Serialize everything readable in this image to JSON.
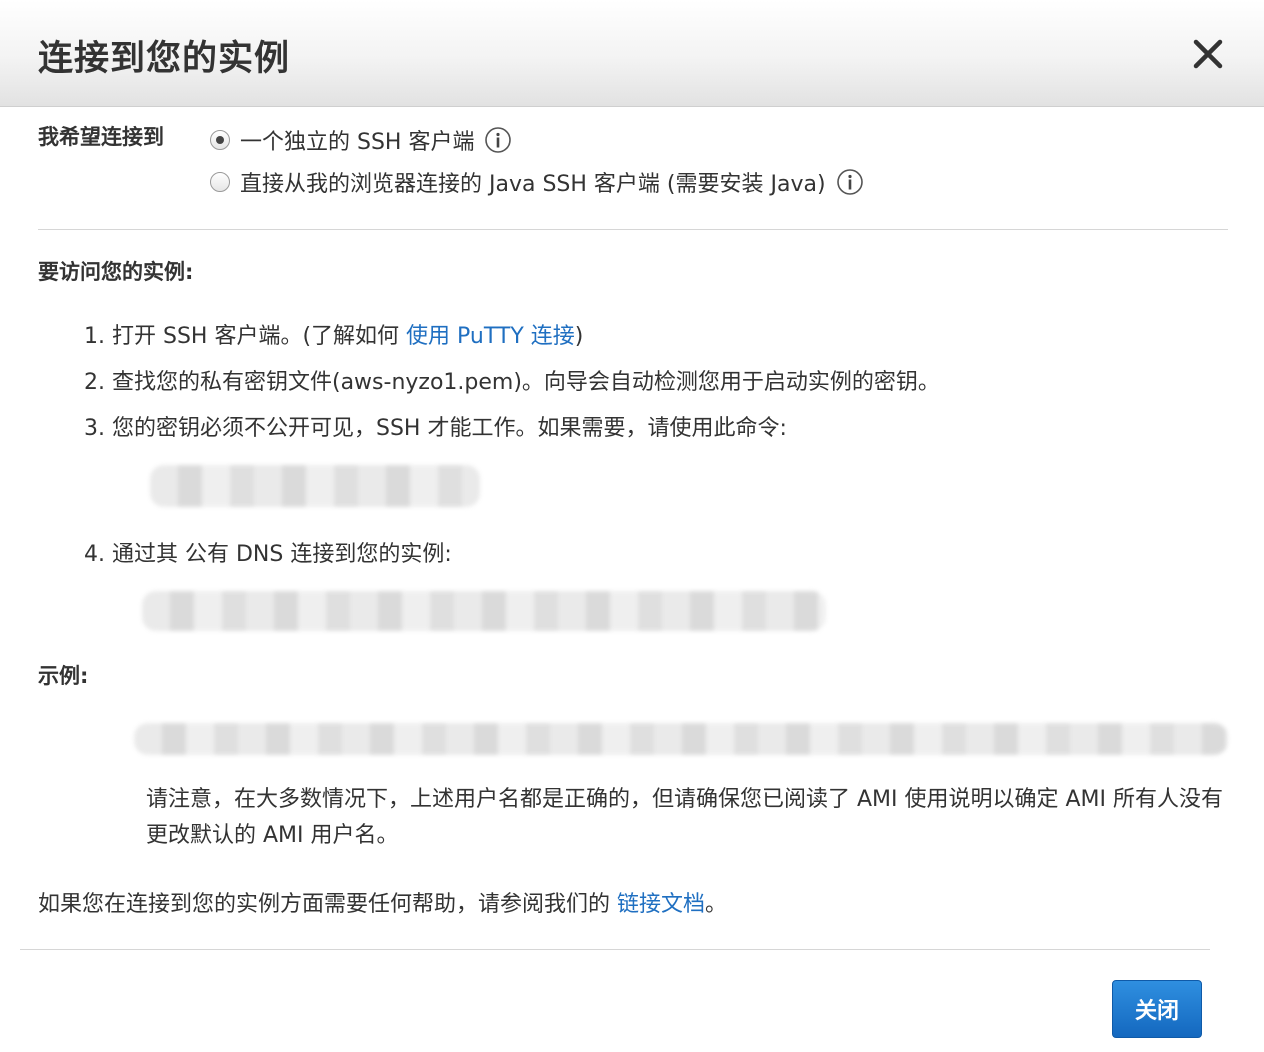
{
  "dialog": {
    "title": "连接到您的实例"
  },
  "connect_option": {
    "label": "我希望连接到",
    "options": [
      {
        "label": "一个独立的 SSH 客户端",
        "selected": true
      },
      {
        "label": "直接从我的浏览器连接的 Java SSH 客户端 (需要安装 Java)",
        "selected": false
      }
    ]
  },
  "access": {
    "heading": "要访问您的实例:",
    "steps": {
      "s1_text": "1. 打开 SSH 客户端。(了解如何 ",
      "s1_link": "使用 PuTTY 连接",
      "s1_end": ")",
      "s2": "2. 查找您的私有密钥文件(aws-nyzo1.pem)。向导会自动检测您用于启动实例的密钥。",
      "s3": "3. 您的密钥必须不公开可见，SSH 才能工作。如果需要，请使用此命令:",
      "s4": "4. 通过其 公有 DNS 连接到您的实例:"
    }
  },
  "example": {
    "heading": "示例:",
    "note": "请注意，在大多数情况下，上述用户名都是正确的，但请确保您已阅读了 AMI 使用说明以确定 AMI 所有人没有更改默认的 AMI 用户名。"
  },
  "help": {
    "text": "如果您在连接到您的实例方面需要任何帮助，请参阅我们的 ",
    "link": "链接文档",
    "end": "。"
  },
  "footer": {
    "close_label": "关闭"
  },
  "icons": {
    "close": "close-icon",
    "info": "info-icon"
  },
  "colors": {
    "link": "#1f6fc1",
    "button": "#1f78d1"
  }
}
